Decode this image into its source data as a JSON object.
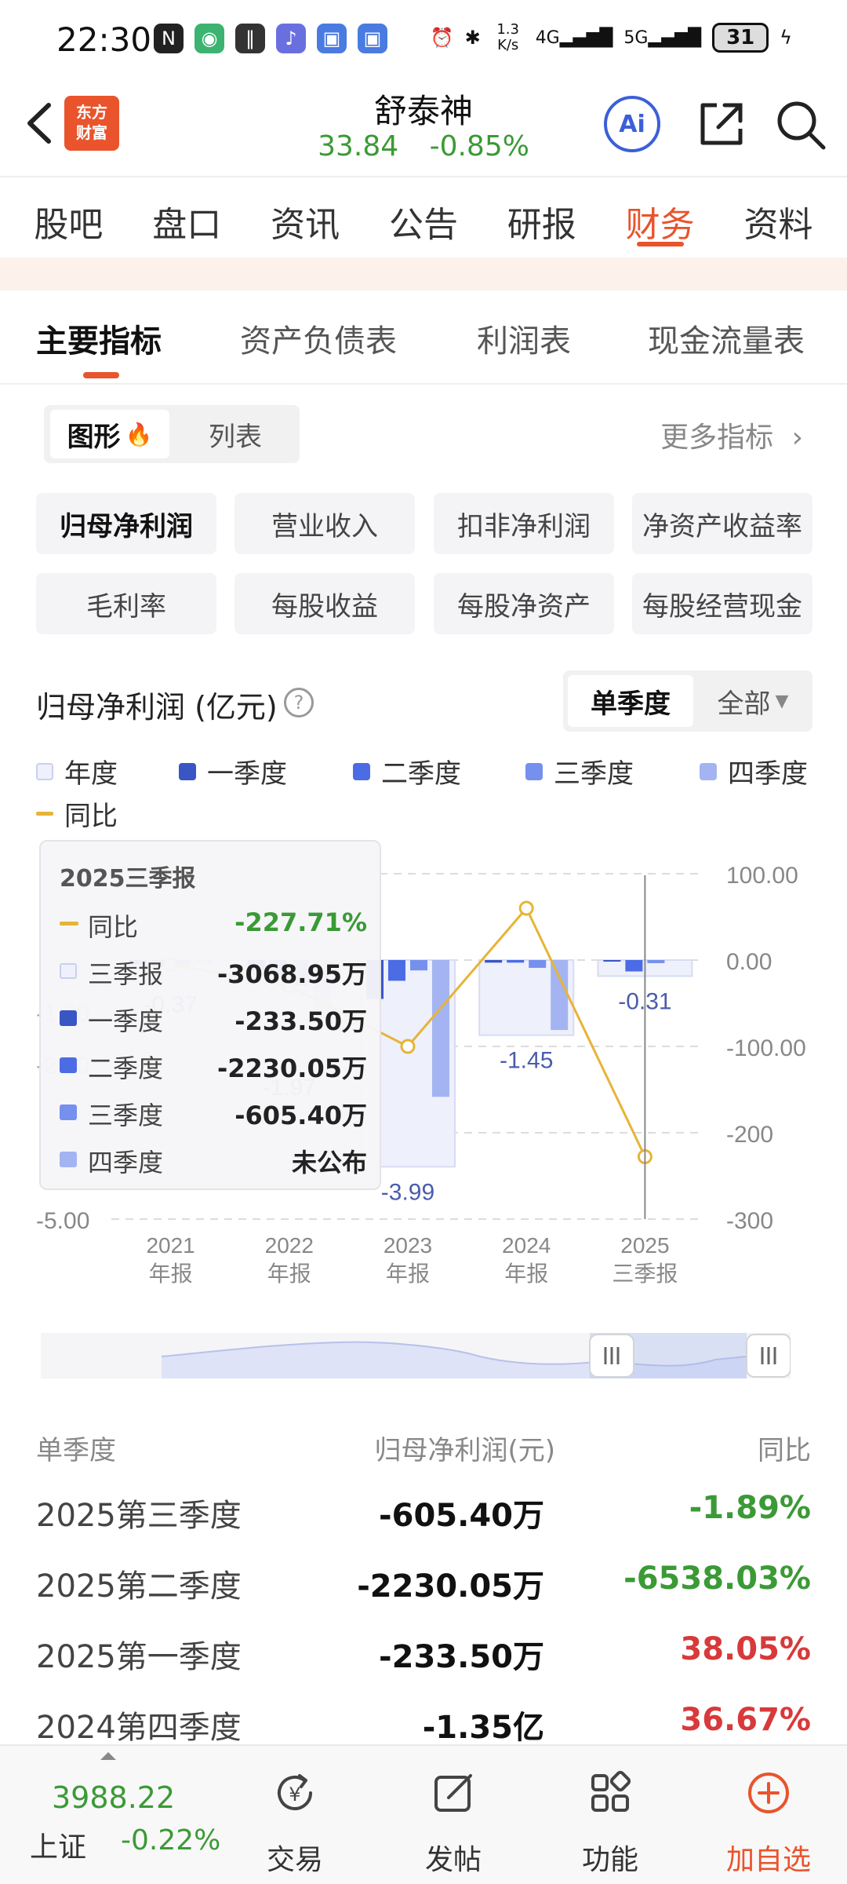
{
  "status_bar": {
    "time": "22:30",
    "net_speed_top": "1.3",
    "net_speed_bottom": "K/s",
    "signal_1": "4G",
    "signal_2": "5G",
    "battery": "31"
  },
  "header": {
    "logo_line1": "东方",
    "logo_line2": "财富",
    "stock_name": "舒泰神",
    "price": "33.84",
    "change": "-0.85%",
    "ai_label": "Ai"
  },
  "nav_tabs": [
    {
      "label": "股吧"
    },
    {
      "label": "盘口"
    },
    {
      "label": "资讯"
    },
    {
      "label": "公告"
    },
    {
      "label": "研报"
    },
    {
      "label": "财务"
    },
    {
      "label": "资料"
    }
  ],
  "sub_tabs": [
    {
      "label": "主要指标"
    },
    {
      "label": "资产负债表"
    },
    {
      "label": "利润表"
    },
    {
      "label": "现金流量表"
    }
  ],
  "view_toggle": {
    "graph": "图形",
    "list": "列表"
  },
  "more_metrics": "更多指标",
  "metric_chips": [
    {
      "label": "归母净利润"
    },
    {
      "label": "营业收入"
    },
    {
      "label": "扣非净利润"
    },
    {
      "label": "净资产收益率"
    },
    {
      "label": "毛利率"
    },
    {
      "label": "每股收益"
    },
    {
      "label": "每股净资产"
    },
    {
      "label": "每股经营现金"
    }
  ],
  "chart_title": "归母净利润 (亿元)",
  "help_symbol": "?",
  "period_toggle": {
    "single": "单季度",
    "all": "全部"
  },
  "legend": [
    {
      "label": "年度",
      "color": "#eef0fb"
    },
    {
      "label": "一季度",
      "color": "#3a55c4"
    },
    {
      "label": "二季度",
      "color": "#4c6ce6"
    },
    {
      "label": "三季度",
      "color": "#7690ee"
    },
    {
      "label": "四季度",
      "color": "#a4b4f2"
    },
    {
      "label": "同比",
      "color": "#e6b437"
    }
  ],
  "chart_data": {
    "type": "bar",
    "categories": [
      "2021\n年报",
      "2022\n年报",
      "2023\n年报",
      "2024\n年报",
      "2025\n三季报"
    ],
    "category_line1": [
      "2021",
      "2022",
      "2023",
      "2024",
      "2025"
    ],
    "category_line2": [
      "年报",
      "年报",
      "年报",
      "年报",
      "三季报"
    ],
    "left_axis_ticks": [
      "-5.00"
    ],
    "right_axis_ticks": [
      "100.00",
      "0.00",
      "-100.00",
      "-200",
      "-300"
    ],
    "ylim_left": [
      -5,
      1
    ],
    "ylim_right": [
      -300,
      100
    ],
    "series": [
      {
        "name": "年度",
        "values": [
          -0.37,
          -1.97,
          -3.99,
          -1.45,
          -0.31
        ]
      },
      {
        "name": "一季度",
        "values": [
          -0.08,
          -0.2,
          -0.75,
          -0.05,
          -0.02
        ]
      },
      {
        "name": "二季度",
        "values": [
          -0.12,
          -0.3,
          -0.4,
          -0.05,
          -0.22
        ]
      },
      {
        "name": "三季度",
        "values": [
          -0.1,
          -0.5,
          -0.2,
          -0.15,
          -0.06
        ]
      },
      {
        "name": "四季度",
        "values": [
          -0.07,
          -0.97,
          -2.64,
          -1.35,
          null
        ]
      },
      {
        "name": "同比",
        "values": [
          -5,
          -30,
          -100,
          60,
          -227.71
        ]
      }
    ],
    "annual_labels": [
      "-0.37",
      "-1.97",
      "-3.99",
      "-1.45",
      "-0.31"
    ],
    "partial_left_labels": [
      "-1.00",
      "-2.00"
    ]
  },
  "tooltip": {
    "title": "2025三季报",
    "rows": [
      {
        "label": "同比",
        "value": "-227.71%",
        "value_color": "#3b9a36"
      },
      {
        "label": "三季报",
        "value": "-3068.95万",
        "swatch": "#eef0fb"
      },
      {
        "label": "一季度",
        "value": "-233.50万",
        "swatch": "#3a55c4"
      },
      {
        "label": "二季度",
        "value": "-2230.05万",
        "swatch": "#4c6ce6"
      },
      {
        "label": "三季度",
        "value": "-605.40万",
        "swatch": "#7690ee"
      },
      {
        "label": "四季度",
        "value": "未公布",
        "swatch": "#a4b4f2"
      }
    ]
  },
  "table": {
    "headers": {
      "period": "单季度",
      "value": "归母净利润(元)",
      "yoy": "同比"
    },
    "rows": [
      {
        "period": "2025第三季度",
        "value": "-605.40万",
        "yoy": "-1.89%",
        "yoy_color": "#3b9a36"
      },
      {
        "period": "2025第二季度",
        "value": "-2230.05万",
        "yoy": "-6538.03%",
        "yoy_color": "#3b9a36"
      },
      {
        "period": "2025第一季度",
        "value": "-233.50万",
        "yoy": "38.05%",
        "yoy_color": "#d8393a"
      },
      {
        "period": "2024第四季度",
        "value": "-1.35亿",
        "yoy": "36.67%",
        "yoy_color": "#d8393a"
      }
    ]
  },
  "bottom_bar": {
    "index_value": "3988.22",
    "index_name": "上证",
    "index_change": "-0.22%",
    "items": [
      {
        "label": "交易",
        "icon": "yen-cycle-icon"
      },
      {
        "label": "发帖",
        "icon": "compose-icon"
      },
      {
        "label": "功能",
        "icon": "grid-icon"
      },
      {
        "label": "加自选",
        "icon": "plus-circle-icon"
      }
    ]
  },
  "colors": {
    "accent": "#e9542c",
    "down_green": "#3b9a36",
    "up_red": "#d8393a",
    "ai_blue": "#3c5fd8"
  }
}
